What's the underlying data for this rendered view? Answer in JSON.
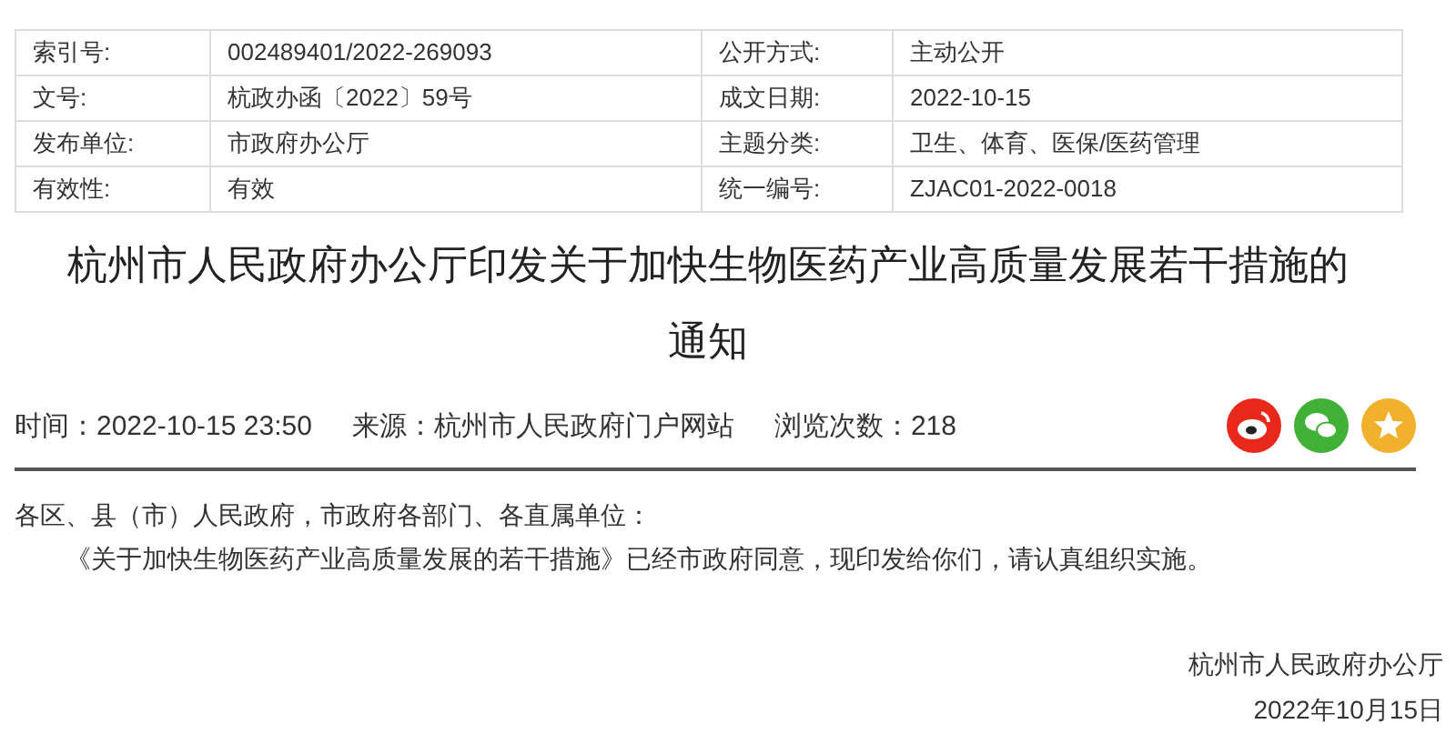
{
  "info_table": [
    {
      "label": "索引号:",
      "value": "002489401/2022-269093"
    },
    {
      "label": "公开方式:",
      "value": "主动公开"
    },
    {
      "label": "文号:",
      "value": "杭政办函〔2022〕59号"
    },
    {
      "label": "成文日期:",
      "value": "2022-10-15"
    },
    {
      "label": "发布单位:",
      "value": "市政府办公厅"
    },
    {
      "label": "主题分类:",
      "value": "卫生、体育、医保/医药管理"
    },
    {
      "label": "有效性:",
      "value": "有效"
    },
    {
      "label": "统一编号:",
      "value": "ZJAC01-2022-0018"
    }
  ],
  "title": "杭州市人民政府办公厅印发关于加快生物医药产业高质量发展若干措施的通知",
  "meta": {
    "time": "时间：2022-10-15 23:50",
    "source": "来源：杭州市人民政府门户网站",
    "views": "浏览次数：218"
  },
  "share_buttons": [
    {
      "kind": "weibo",
      "color": "#e8281b"
    },
    {
      "kind": "wechat",
      "color": "#3fb136"
    },
    {
      "kind": "favorite",
      "color": "#f2b12c"
    }
  ],
  "body": {
    "salutation": "各区、县（市）人民政府，市政府各部门、各直属单位：",
    "paragraphs": [
      "《关于加快生物医药产业高质量发展的若干措施》已经市政府同意，现印发给你们，请认真组织实施。"
    ]
  },
  "signature": {
    "issuer": "杭州市人民政府办公厅",
    "date": "2022年10月15日"
  }
}
